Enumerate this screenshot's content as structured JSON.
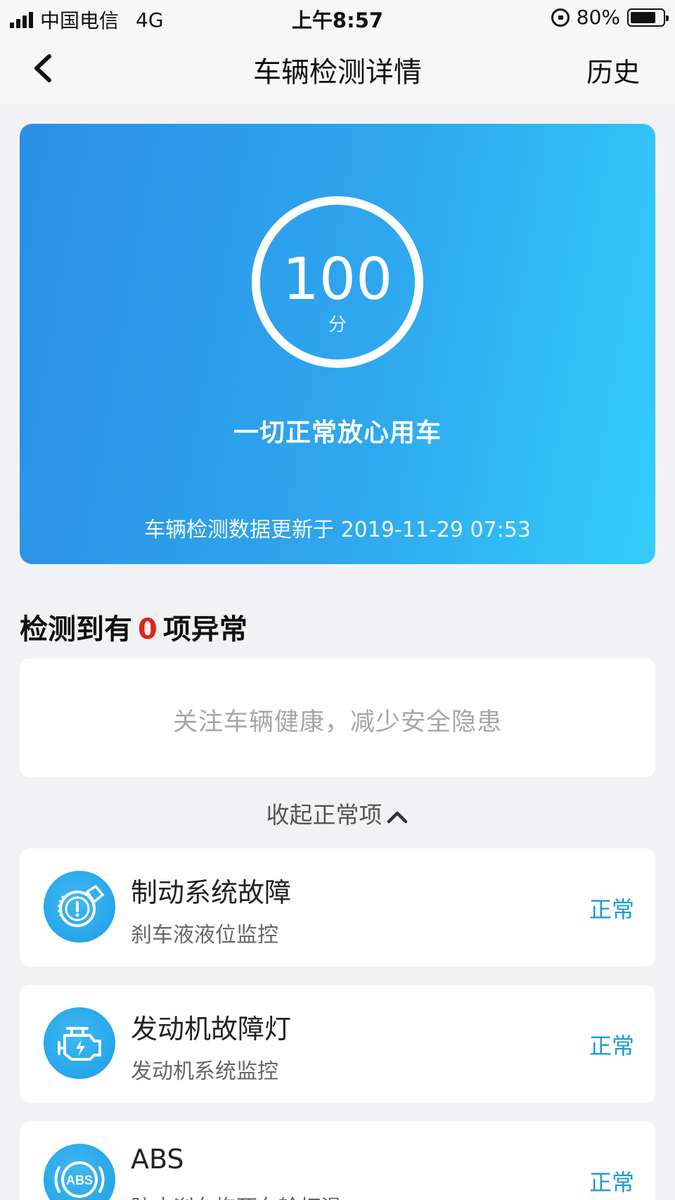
{
  "status_bar": {
    "carrier": "中国电信",
    "network": "4G",
    "time": "上午8:57",
    "battery": "80%",
    "battery_level": 0.8
  },
  "nav": {
    "back_icon": "chevron-left-icon",
    "title": "车辆检测详情",
    "history_label": "历史"
  },
  "score": {
    "value": "100",
    "unit": "分",
    "status_text": "一切正常放心用车",
    "update_text": "车辆检测数据更新于 2019-11-29 07:53"
  },
  "anomaly": {
    "prefix": "检测到有",
    "count": "0",
    "suffix": "项异常",
    "count_color": "#e0251b"
  },
  "tip": {
    "text": "关注车辆健康，减少安全隐患"
  },
  "collapse": {
    "label": "收起正常项",
    "icon": "chevron-up-icon"
  },
  "items": [
    {
      "title": "制动系统故障",
      "subtitle": "刹车液液位监控",
      "status": "正常",
      "icon": "brake-warning-icon"
    },
    {
      "title": "发动机故障灯",
      "subtitle": "发动机系统监控",
      "status": "正常",
      "icon": "engine-icon"
    },
    {
      "title": "ABS",
      "subtitle": "防止刹车抱死车轮打滑",
      "status": "正常",
      "icon": "abs-icon",
      "icon_text": "ABS"
    }
  ],
  "colors": {
    "accent": "#1b9bd8",
    "card_gradient_start": "#2a8fe6",
    "card_gradient_end": "#33cdfb"
  }
}
